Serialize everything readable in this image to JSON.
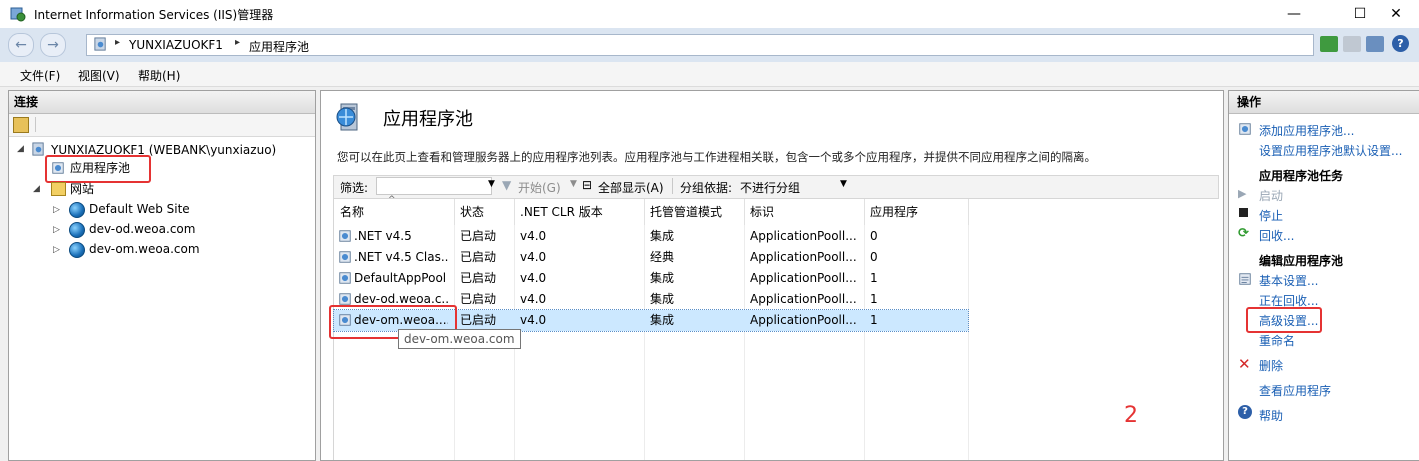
{
  "window": {
    "title": "Internet Information Services (IIS)管理器",
    "minimize": "—",
    "maximize": "☐",
    "close": "✕"
  },
  "address": {
    "crumbs": [
      "YUNXIAZUOKF1",
      "应用程序池"
    ],
    "sep": "▸"
  },
  "menu": {
    "items": [
      "文件(F)",
      "视图(V)",
      "帮助(H)"
    ]
  },
  "connections": {
    "header": "连接",
    "server": "YUNXIAZUOKF1 (WEBANK\\yunxiazuo)",
    "app_pools": "应用程序池",
    "sites": "网站",
    "site_list": [
      "Default Web Site",
      "dev-od.weoa.com",
      "dev-om.weoa.com"
    ]
  },
  "main": {
    "title": "应用程序池",
    "description": "您可以在此页上查看和管理服务器上的应用程序池列表。应用程序池与工作进程相关联，包含一个或多个应用程序，并提供不同应用程序之间的隔离。",
    "filter_label": "筛选:",
    "filter_value": "",
    "start_label": "开始(G)",
    "show_all_label": "全部显示(A)",
    "group_by_label": "分组依据:",
    "group_by_value": "不进行分组",
    "columns": [
      "名称",
      "状态",
      ".NET CLR 版本",
      "托管管道模式",
      "标识",
      "应用程序"
    ],
    "rows": [
      [
        ".NET v4.5",
        "已启动",
        "v4.0",
        "集成",
        "ApplicationPooll...",
        "0"
      ],
      [
        ".NET v4.5 Clas...",
        "已启动",
        "v4.0",
        "经典",
        "ApplicationPooll...",
        "0"
      ],
      [
        "DefaultAppPool",
        "已启动",
        "v4.0",
        "集成",
        "ApplicationPooll...",
        "1"
      ],
      [
        "dev-od.weoa.c...",
        "已启动",
        "v4.0",
        "集成",
        "ApplicationPooll...",
        "1"
      ],
      [
        "dev-om.weoa....",
        "已启动",
        "v4.0",
        "集成",
        "ApplicationPooll...",
        "1"
      ]
    ],
    "tooltip": "dev-om.weoa.com"
  },
  "actions": {
    "header": "操作",
    "add_pool": "添加应用程序池...",
    "set_defaults": "设置应用程序池默认设置...",
    "tasks_header": "应用程序池任务",
    "start": "启动",
    "stop": "停止",
    "recycle": "回收...",
    "edit_header": "编辑应用程序池",
    "basic_settings": "基本设置...",
    "recycling": "正在回收...",
    "advanced_settings": "高级设置...",
    "rename": "重命名",
    "delete": "删除",
    "view_apps": "查看应用程序",
    "help": "帮助"
  },
  "annotation": "2",
  "colors": {
    "accent_link": "#1a5fb4",
    "highlight_box": "#e53333",
    "selected_row": "#cce8ff"
  }
}
